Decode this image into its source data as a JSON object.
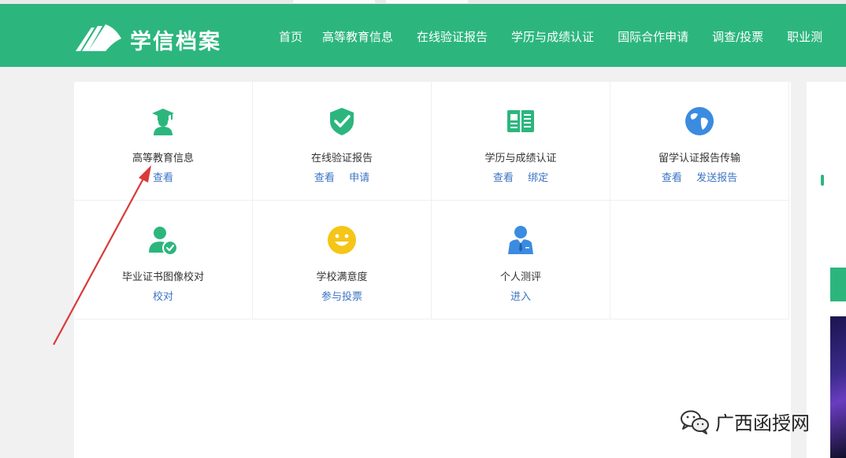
{
  "header": {
    "logo_text": "学信档案",
    "nav": [
      "首页",
      "高等教育信息",
      "在线验证报告",
      "学历与成绩认证",
      "国际合作申请",
      "调查/投票",
      "职业测"
    ]
  },
  "tiles": [
    {
      "label": "高等教育信息",
      "links": [
        "查看"
      ],
      "icon": "graduate-icon"
    },
    {
      "label": "在线验证报告",
      "links": [
        "查看",
        "申请"
      ],
      "icon": "shield-check-icon"
    },
    {
      "label": "学历与成绩认证",
      "links": [
        "查看",
        "绑定"
      ],
      "icon": "book-icon"
    },
    {
      "label": "留学认证报告传输",
      "links": [
        "查看",
        "发送报告"
      ],
      "icon": "globe-icon"
    },
    {
      "label": "毕业证书图像校对",
      "links": [
        "校对"
      ],
      "icon": "user-check-icon"
    },
    {
      "label": "学校满意度",
      "links": [
        "参与投票"
      ],
      "icon": "smiley-icon"
    },
    {
      "label": "个人测评",
      "links": [
        "进入"
      ],
      "icon": "person-suit-icon"
    }
  ],
  "watermark": {
    "text": "广西函授网",
    "icon": "wechat-icon"
  },
  "colors": {
    "brand": "#2cb67e",
    "link": "#3b74c3",
    "arrow": "#d93a3a"
  }
}
